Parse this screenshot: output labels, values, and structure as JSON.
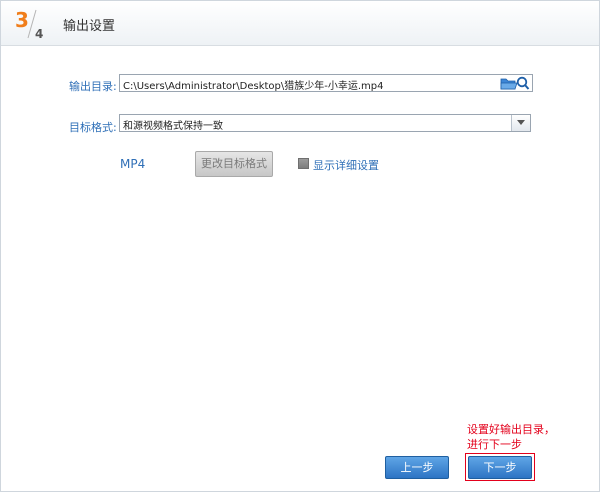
{
  "header": {
    "step_current": "3",
    "step_total": "4",
    "title": "输出设置"
  },
  "output_dir": {
    "label": "输出目录:",
    "value": "C:\\Users\\Administrator\\Desktop\\猎族少年-小幸运.mp4",
    "browse_icon": "folder-search-icon"
  },
  "target_format": {
    "label": "目标格式:",
    "value": "和源视频格式保持一致"
  },
  "format_tag": "MP4",
  "change_format_label": "更改目标格式",
  "show_details": {
    "label": "显示详细设置",
    "checked": false
  },
  "annotation": {
    "line1": "设置好输出目录，",
    "line2": "进行下一步"
  },
  "nav": {
    "prev_label": "上一步",
    "next_label": "下一步"
  },
  "colors": {
    "accent": "#2f6fb7",
    "step_orange": "#f07e1b",
    "annotation_red": "#e3001b"
  }
}
